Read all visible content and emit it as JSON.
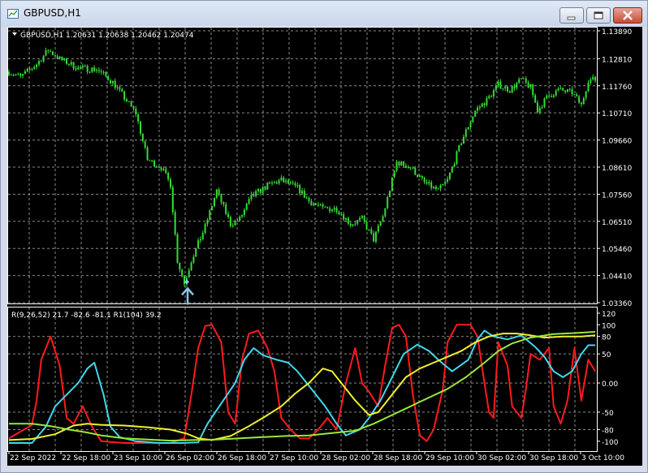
{
  "window": {
    "title": "GBPUSD,H1"
  },
  "chart_data": [
    {
      "type": "candlestick",
      "title": "GBPUSD,H1  1.20631 1.20638 1.20462 1.20474",
      "ohlc_readout": {
        "open": 1.20631,
        "high": 1.20638,
        "low": 1.20462,
        "close": 1.20474
      },
      "ylim": [
        1.0336,
        1.1389
      ],
      "y_ticks": [
        "1.13890",
        "1.12810",
        "1.11760",
        "1.10710",
        "1.09660",
        "1.08610",
        "1.07560",
        "1.06510",
        "1.05460",
        "1.04410",
        "1.03360"
      ],
      "bull_color": "#33dd33",
      "bear_color": "#33dd33",
      "path": [
        [
          0,
          1.123
        ],
        [
          5,
          1.121
        ],
        [
          12,
          1.126
        ],
        [
          17,
          1.1315
        ],
        [
          22,
          1.128
        ],
        [
          30,
          1.1245
        ],
        [
          38,
          1.124
        ],
        [
          45,
          1.119
        ],
        [
          55,
          1.107
        ],
        [
          60,
          1.089
        ],
        [
          66,
          1.086
        ],
        [
          70,
          1.0795
        ],
        [
          73,
          1.05
        ],
        [
          76,
          1.041
        ],
        [
          79,
          1.05
        ],
        [
          85,
          1.063
        ],
        [
          90,
          1.077
        ],
        [
          96,
          1.064
        ],
        [
          100,
          1.066
        ],
        [
          105,
          1.0745
        ],
        [
          112,
          1.079
        ],
        [
          118,
          1.081
        ],
        [
          125,
          1.078
        ],
        [
          130,
          1.073
        ],
        [
          136,
          1.07
        ],
        [
          142,
          1.07
        ],
        [
          148,
          1.064
        ],
        [
          153,
          1.066
        ],
        [
          158,
          1.058
        ],
        [
          162,
          1.067
        ],
        [
          168,
          1.088
        ],
        [
          174,
          1.086
        ],
        [
          180,
          1.08
        ],
        [
          186,
          1.077
        ],
        [
          190,
          1.081
        ],
        [
          196,
          1.096
        ],
        [
          202,
          1.108
        ],
        [
          207,
          1.112
        ],
        [
          212,
          1.118
        ],
        [
          217,
          1.116
        ],
        [
          222,
          1.12
        ],
        [
          226,
          1.117
        ],
        [
          229,
          1.108
        ],
        [
          233,
          1.113
        ],
        [
          238,
          1.116
        ],
        [
          244,
          1.115
        ],
        [
          248,
          1.11
        ],
        [
          251,
          1.12
        ],
        [
          254,
          1.12
        ]
      ],
      "marker": {
        "index": 76,
        "color": "#87c6ea"
      }
    },
    {
      "type": "line",
      "title": "R(9,26,52) 21.7 -82.6 -81.1  R1(104) 39.2",
      "ylim": [
        -110,
        120
      ],
      "y_ticks": [
        "120",
        "100",
        "80",
        "50",
        "0.00",
        "-50",
        "-80",
        "-100"
      ],
      "series": [
        {
          "color": "#ff1a1a",
          "points": [
            [
              0,
              -95
            ],
            [
              10,
              -72
            ],
            [
              12,
              -30
            ],
            [
              14,
              40
            ],
            [
              18,
              80
            ],
            [
              22,
              30
            ],
            [
              25,
              -60
            ],
            [
              28,
              -70
            ],
            [
              32,
              -40
            ],
            [
              36,
              -75
            ],
            [
              40,
              -100
            ],
            [
              50,
              -103
            ],
            [
              70,
              -103
            ],
            [
              76,
              -95
            ],
            [
              79,
              -20
            ],
            [
              82,
              60
            ],
            [
              85,
              98
            ],
            [
              88,
              100
            ],
            [
              92,
              70
            ],
            [
              95,
              -50
            ],
            [
              98,
              -70
            ],
            [
              101,
              40
            ],
            [
              104,
              85
            ],
            [
              108,
              90
            ],
            [
              112,
              60
            ],
            [
              115,
              20
            ],
            [
              118,
              -60
            ],
            [
              122,
              -80
            ],
            [
              126,
              -95
            ],
            [
              130,
              -95
            ],
            [
              134,
              -80
            ],
            [
              138,
              -60
            ],
            [
              142,
              -80
            ],
            [
              146,
              0
            ],
            [
              150,
              60
            ],
            [
              153,
              0
            ],
            [
              156,
              -15
            ],
            [
              160,
              -40
            ],
            [
              163,
              30
            ],
            [
              166,
              95
            ],
            [
              169,
              100
            ],
            [
              172,
              80
            ],
            [
              175,
              -20
            ],
            [
              178,
              -90
            ],
            [
              181,
              -100
            ],
            [
              184,
              -80
            ],
            [
              188,
              -10
            ],
            [
              190,
              70
            ],
            [
              194,
              100
            ],
            [
              200,
              100
            ],
            [
              203,
              80
            ],
            [
              206,
              0
            ],
            [
              208,
              -50
            ],
            [
              210,
              -60
            ],
            [
              212,
              70
            ],
            [
              216,
              30
            ],
            [
              218,
              -40
            ],
            [
              222,
              -60
            ],
            [
              224,
              -10
            ],
            [
              226,
              50
            ],
            [
              230,
              40
            ],
            [
              234,
              60
            ],
            [
              236,
              -40
            ],
            [
              239,
              -70
            ],
            [
              242,
              -30
            ],
            [
              245,
              60
            ],
            [
              248,
              -30
            ],
            [
              251,
              40
            ],
            [
              254,
              20
            ]
          ]
        },
        {
          "color": "#3fd8ec",
          "points": [
            [
              0,
              -103
            ],
            [
              10,
              -103
            ],
            [
              16,
              -75
            ],
            [
              20,
              -40
            ],
            [
              25,
              -20
            ],
            [
              30,
              0
            ],
            [
              34,
              25
            ],
            [
              37,
              35
            ],
            [
              41,
              -20
            ],
            [
              44,
              -75
            ],
            [
              48,
              -93
            ],
            [
              55,
              -100
            ],
            [
              65,
              -103
            ],
            [
              75,
              -103
            ],
            [
              82,
              -102
            ],
            [
              86,
              -70
            ],
            [
              92,
              -35
            ],
            [
              98,
              0
            ],
            [
              102,
              40
            ],
            [
              106,
              60
            ],
            [
              110,
              48
            ],
            [
              116,
              40
            ],
            [
              121,
              35
            ],
            [
              125,
              20
            ],
            [
              131,
              -10
            ],
            [
              137,
              -40
            ],
            [
              142,
              -70
            ],
            [
              146,
              -90
            ],
            [
              152,
              -80
            ],
            [
              156,
              -60
            ],
            [
              161,
              -30
            ],
            [
              166,
              10
            ],
            [
              171,
              50
            ],
            [
              177,
              66
            ],
            [
              182,
              55
            ],
            [
              186,
              40
            ],
            [
              192,
              20
            ],
            [
              199,
              40
            ],
            [
              203,
              75
            ],
            [
              206,
              90
            ],
            [
              210,
              80
            ],
            [
              216,
              75
            ],
            [
              222,
              82
            ],
            [
              228,
              62
            ],
            [
              232,
              45
            ],
            [
              236,
              20
            ],
            [
              240,
              10
            ],
            [
              244,
              20
            ],
            [
              248,
              50
            ],
            [
              251,
              65
            ],
            [
              254,
              65
            ]
          ]
        },
        {
          "color": "#f0f030",
          "points": [
            [
              0,
              -98
            ],
            [
              10,
              -96
            ],
            [
              20,
              -88
            ],
            [
              28,
              -73
            ],
            [
              34,
              -70
            ],
            [
              40,
              -72
            ],
            [
              50,
              -73
            ],
            [
              60,
              -76
            ],
            [
              70,
              -80
            ],
            [
              77,
              -87
            ],
            [
              82,
              -95
            ],
            [
              88,
              -98
            ],
            [
              96,
              -91
            ],
            [
              104,
              -74
            ],
            [
              110,
              -60
            ],
            [
              118,
              -40
            ],
            [
              124,
              -18
            ],
            [
              130,
              0
            ],
            [
              136,
              25
            ],
            [
              140,
              20
            ],
            [
              144,
              0
            ],
            [
              150,
              -30
            ],
            [
              156,
              -55
            ],
            [
              160,
              -50
            ],
            [
              166,
              -20
            ],
            [
              172,
              10
            ],
            [
              178,
              25
            ],
            [
              184,
              35
            ],
            [
              190,
              45
            ],
            [
              196,
              55
            ],
            [
              202,
              70
            ],
            [
              208,
              80
            ],
            [
              214,
              85
            ],
            [
              220,
              85
            ],
            [
              226,
              82
            ],
            [
              232,
              78
            ],
            [
              240,
              80
            ],
            [
              248,
              80
            ],
            [
              254,
              82
            ]
          ]
        },
        {
          "color": "#9ae83a",
          "points": [
            [
              0,
              -70
            ],
            [
              10,
              -70
            ],
            [
              18,
              -74
            ],
            [
              26,
              -80
            ],
            [
              34,
              -85
            ],
            [
              40,
              -90
            ],
            [
              50,
              -95
            ],
            [
              60,
              -97
            ],
            [
              70,
              -99
            ],
            [
              80,
              -98
            ],
            [
              90,
              -97
            ],
            [
              100,
              -95
            ],
            [
              110,
              -93
            ],
            [
              120,
              -91
            ],
            [
              130,
              -90
            ],
            [
              140,
              -86
            ],
            [
              150,
              -82
            ],
            [
              158,
              -70
            ],
            [
              166,
              -55
            ],
            [
              174,
              -40
            ],
            [
              182,
              -25
            ],
            [
              190,
              -10
            ],
            [
              198,
              10
            ],
            [
              206,
              35
            ],
            [
              212,
              55
            ],
            [
              218,
              68
            ],
            [
              226,
              78
            ],
            [
              236,
              84
            ],
            [
              246,
              86
            ],
            [
              254,
              88
            ]
          ]
        }
      ]
    }
  ],
  "x_ticks": [
    "22 Sep 2022",
    "22 Sep 18:00",
    "23 Sep 10:00",
    "26 Sep 02:00",
    "26 Sep 18:00",
    "27 Sep 10:00",
    "28 Sep 02:00",
    "28 Sep 18:00",
    "29 Sep 10:00",
    "30 Sep 02:00",
    "30 Sep 18:00",
    "3 Oct 10:00"
  ]
}
